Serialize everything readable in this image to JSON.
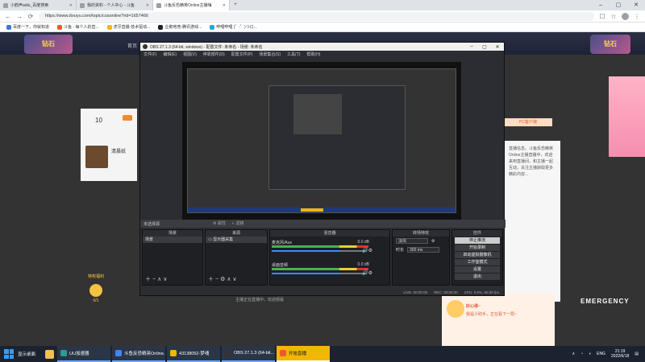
{
  "tabs": [
    {
      "label": "小鹤声aidu_百度搜索"
    },
    {
      "label": "我的资料 - 个人中心 - 斗鱼"
    },
    {
      "label": "斗鱼反恐精英Online主播嗨"
    }
  ],
  "browser": {
    "url": "https://www.douyu.com/topic/cssonline?rid=1657466",
    "bookmarks": [
      "百度一下，你就知道",
      "斗鱼 - 每个人的直...",
      "虎牙直播-技术驱动...",
      "企鹅电竞-腾讯游戏...",
      "哔哩哔哩 (゜-゜)つロ..."
    ]
  },
  "page": {
    "left_logo": "钻石",
    "right_logo": "钻石",
    "header_text": "首页",
    "left_number": "10",
    "streamer_name": "清晨纸",
    "badge_title": "特权福利",
    "badge_count": "0/1",
    "pc_btn": "PC客户端",
    "right_panel_text": "直播信息。斗鱼反恐精英Online主播直播中，欢迎来到直播间，和主播一起互动，关注主播获取更多精彩内容...",
    "chat_greeting": "好心得~",
    "chat_line": "我是小助手，正在看下一局~",
    "emerge": "EMERGENCY",
    "underline": "主播正在直播中，欢迎观看"
  },
  "obs": {
    "title": "OBS 27.1.3 (64-bit, windows) - 配置文件: 未命名 - 场景: 未命名",
    "menu": [
      "文件(F)",
      "编辑(E)",
      "视图(V)",
      "停靠部件(D)",
      "配置文件(P)",
      "场景集合(S)",
      "工具(T)",
      "帮助(H)"
    ],
    "no_source": "未选择源",
    "props": "属性",
    "filters": "滤镜",
    "docks": {
      "scenes": "场景",
      "sources": "来源",
      "mixer": "混音器",
      "transitions": "转场特效",
      "controls": "控件"
    },
    "scene_item": "场景",
    "source_item": "显示器采集",
    "mixer_channels": [
      {
        "name": "桌面音频",
        "db": "0.0 dB"
      },
      {
        "name": "麦克风/Aux",
        "db": "0.0 dB"
      }
    ],
    "transition": {
      "type": "淡出",
      "duration_label": "时长",
      "duration": "300 ms"
    },
    "controls": [
      "停止推流",
      "开始录制",
      "启动虚拟摄像机",
      "工作室模式",
      "设置",
      "退出"
    ],
    "status": [
      "LIVE: 00:00:00",
      "REC: 00:00:00",
      "CPU: 0.5%, 60.00 fps"
    ]
  },
  "taskbar": {
    "search": "显示桌面",
    "items": [
      "UU加速器",
      "斗鱼反恐精英Online...",
      "43138052-梦魂",
      "OBS 27.1.3 (64-bit...",
      "开始直播"
    ],
    "lang": "ENG",
    "time": "21:19",
    "date": "2022/6/18"
  }
}
